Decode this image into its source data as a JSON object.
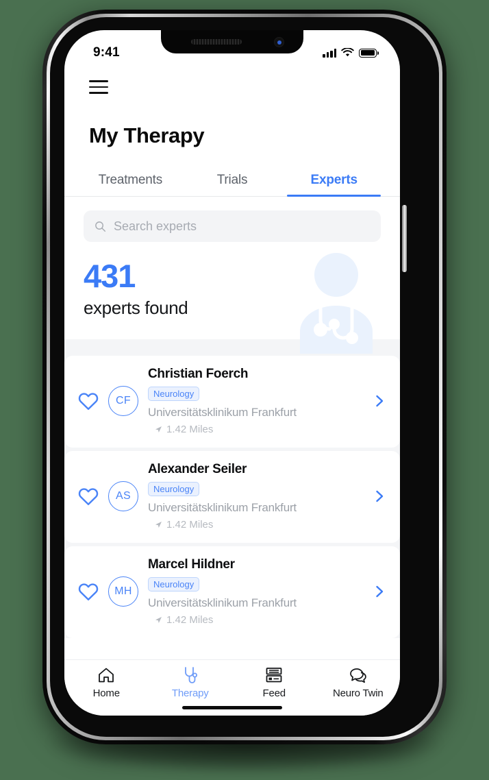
{
  "status_bar": {
    "time": "9:41",
    "signal_icon": "cellular-signal-icon",
    "wifi_icon": "wifi-icon",
    "battery_icon": "battery-full-icon"
  },
  "app_bar": {
    "menu_icon": "hamburger-menu-icon"
  },
  "header": {
    "title": "My Therapy",
    "tabs": [
      {
        "label": "Treatments",
        "active": false
      },
      {
        "label": "Trials",
        "active": false
      },
      {
        "label": "Experts",
        "active": true
      }
    ]
  },
  "search": {
    "placeholder": "Search experts",
    "value": "",
    "icon": "search-icon"
  },
  "stats": {
    "count": "431",
    "label": "experts found",
    "illustration": "doctor-with-stethoscope-illustration"
  },
  "experts": [
    {
      "name": "Christian Foerch",
      "initials": "CF",
      "specialty": "Neurology",
      "organization": "Universitätsklinikum Frankfurt",
      "distance": "1.42 Miles",
      "favorite_icon": "heart-outline-icon",
      "distance_icon": "navigation-arrow-icon",
      "chevron_icon": "chevron-right-icon"
    },
    {
      "name": "Alexander Seiler",
      "initials": "AS",
      "specialty": "Neurology",
      "organization": "Universitätsklinikum Frankfurt",
      "distance": "1.42 Miles",
      "favorite_icon": "heart-outline-icon",
      "distance_icon": "navigation-arrow-icon",
      "chevron_icon": "chevron-right-icon"
    },
    {
      "name": "Marcel Hildner",
      "initials": "MH",
      "specialty": "Neurology",
      "organization": "Universitätsklinikum Frankfurt",
      "distance": "1.42 Miles",
      "favorite_icon": "heart-outline-icon",
      "distance_icon": "navigation-arrow-icon",
      "chevron_icon": "chevron-right-icon"
    }
  ],
  "bottom_nav": [
    {
      "label": "Home",
      "icon": "home-icon",
      "active": false
    },
    {
      "label": "Therapy",
      "icon": "stethoscope-icon",
      "active": true
    },
    {
      "label": "Feed",
      "icon": "feed-list-icon",
      "active": false
    },
    {
      "label": "Neuro Twin",
      "icon": "chat-bubbles-icon",
      "active": false
    }
  ],
  "colors": {
    "accent": "#3b7bf6",
    "accent_light": "#6f9cf8",
    "muted_text": "#9ca1a8",
    "background": "#4a7050",
    "surface": "#ffffff",
    "band": "#f4f5f7"
  }
}
